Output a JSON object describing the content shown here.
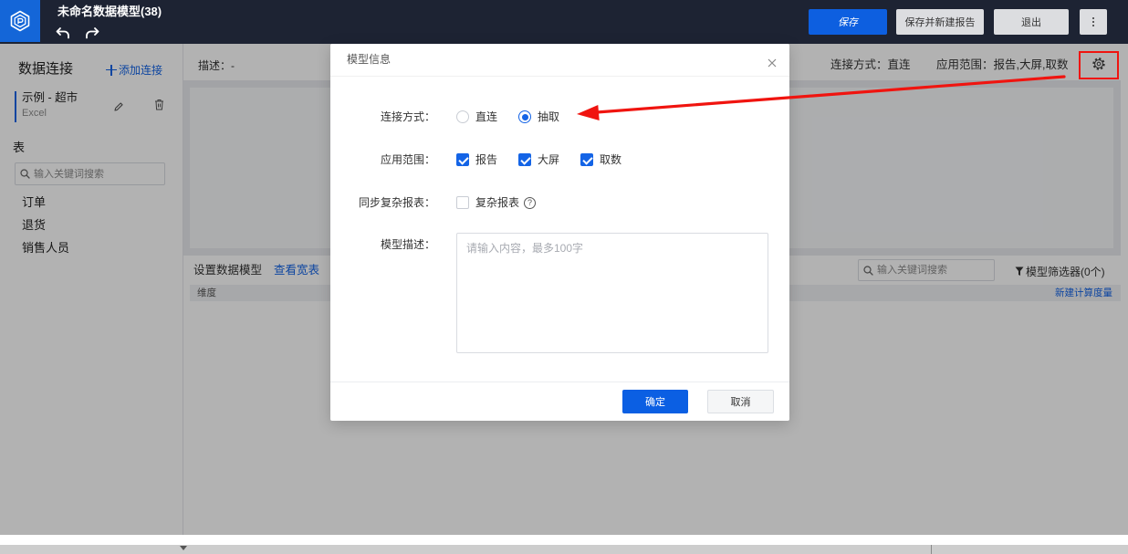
{
  "topbar": {
    "title": "未命名数据模型(38)",
    "save_label": "保存",
    "save_and_new_report_label": "保存并新建报告",
    "exit_label": "退出"
  },
  "sidebar": {
    "title": "数据连接",
    "add_connection_label": "添加连接",
    "connection": {
      "name": "示例 - 超市",
      "type": "Excel"
    },
    "tables_title": "表",
    "search_placeholder": "输入关键词搜索",
    "tables": [
      {
        "label": "订单"
      },
      {
        "label": "退货"
      },
      {
        "label": "销售人员"
      }
    ]
  },
  "header": {
    "description": "描述：-",
    "connection_mode": "连接方式：直连",
    "scope": "应用范围：报告,大屏,取数"
  },
  "model": {
    "title": "设置数据模型",
    "view_wide_table": "查看宽表",
    "search_placeholder": "输入关键词搜索",
    "filter_label": "模型筛选器(0个)",
    "dimension_header": "维度",
    "new_measure": "新建计算度量"
  },
  "modal": {
    "title": "模型信息",
    "connection_mode": {
      "label": "连接方式：",
      "options": [
        {
          "label": "直连",
          "checked": false
        },
        {
          "label": "抽取",
          "checked": true
        }
      ]
    },
    "scope": {
      "label": "应用范围：",
      "options": [
        {
          "label": "报告",
          "checked": true
        },
        {
          "label": "大屏",
          "checked": true
        },
        {
          "label": "取数",
          "checked": true
        }
      ]
    },
    "sync_report": {
      "label": "同步复杂报表：",
      "option": {
        "label": "复杂报表",
        "checked": false
      }
    },
    "description": {
      "label": "模型描述：",
      "placeholder": "请输入内容，最多100字"
    },
    "confirm_label": "确定",
    "cancel_label": "取消"
  },
  "colors": {
    "accent": "#1464e6",
    "annotation": "#f0140f"
  }
}
